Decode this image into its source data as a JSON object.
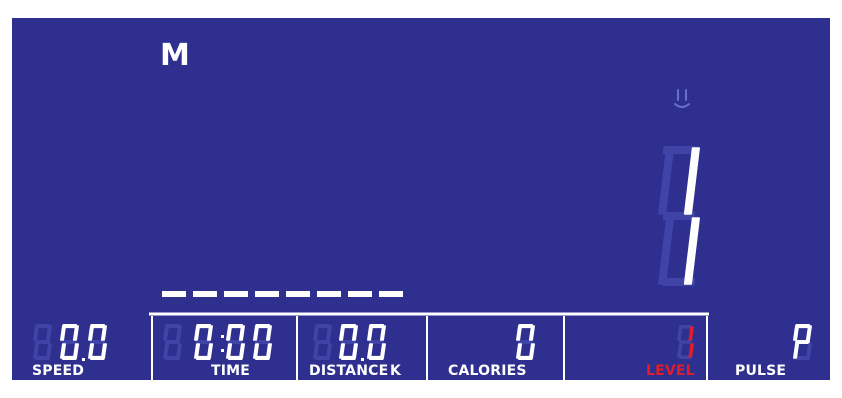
{
  "display": {
    "mode_letter": "M",
    "colors": {
      "background": "#2e2f8e",
      "segment_on": "#ffffff",
      "segment_off": "#3f44a6",
      "accent": "#e11d2a",
      "border": "#ffffff"
    },
    "profile_bars_lit": 8,
    "resistance_level": "1",
    "heart_icon": "heart-outline-icon",
    "metrics": {
      "speed": {
        "label": "SPEED",
        "value": "0.0"
      },
      "time": {
        "label": "TIME",
        "value": "0:00"
      },
      "distance": {
        "label": "DISTANCE",
        "unit": "K",
        "value": "0.0"
      },
      "calories": {
        "label": "CALORIES",
        "value": "0"
      },
      "level": {
        "label": "LEVEL",
        "value": "1"
      },
      "pulse": {
        "label": "PULSE",
        "value": "P"
      }
    }
  }
}
